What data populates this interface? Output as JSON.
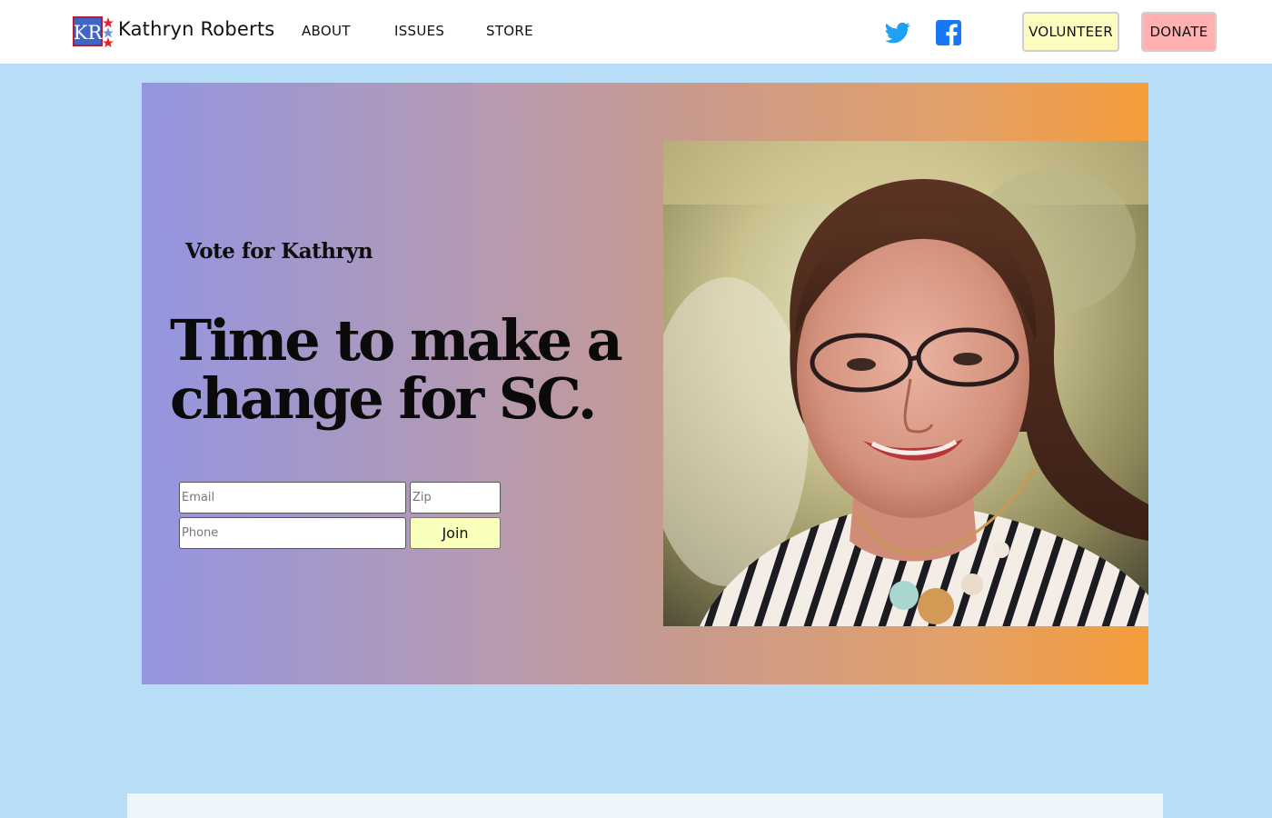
{
  "nav": {
    "logo_text": "KR",
    "brand": "Kathryn Roberts",
    "links": [
      "ABOUT",
      "ISSUES",
      "STORE"
    ],
    "social": [
      "twitter-icon",
      "facebook-icon"
    ],
    "volunteer_label": "VOLUNTEER",
    "donate_label": "DONATE"
  },
  "hero": {
    "eyebrow": "Vote for Kathryn",
    "headline": "Time to make a change for SC.",
    "email_placeholder": "Email",
    "zip_placeholder": "Zip",
    "phone_placeholder": "Phone",
    "join_label": "Join"
  },
  "colors": {
    "page_bg": "#b8ddf7",
    "volunteer_bg": "#fcfcbf",
    "donate_bg": "#ffb0b0",
    "gradient_start": "#9495e0",
    "gradient_end": "#f59d3a",
    "twitter": "#1da1f2",
    "facebook": "#1877f2"
  }
}
